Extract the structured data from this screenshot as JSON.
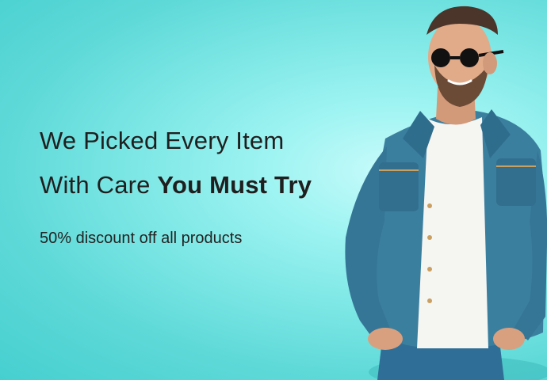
{
  "hero": {
    "headline_line1": "We Picked Every Item",
    "headline_line2_regular": "With Care ",
    "headline_line2_bold": "You Must Try",
    "subtitle": "50% discount off all products"
  },
  "colors": {
    "background": "#7fe8e6",
    "text": "#1f1f1f",
    "denim": "#3b7f9f",
    "shirt": "#f5f5f2"
  },
  "image": {
    "subject": "man-in-denim-jacket-with-sunglasses"
  }
}
